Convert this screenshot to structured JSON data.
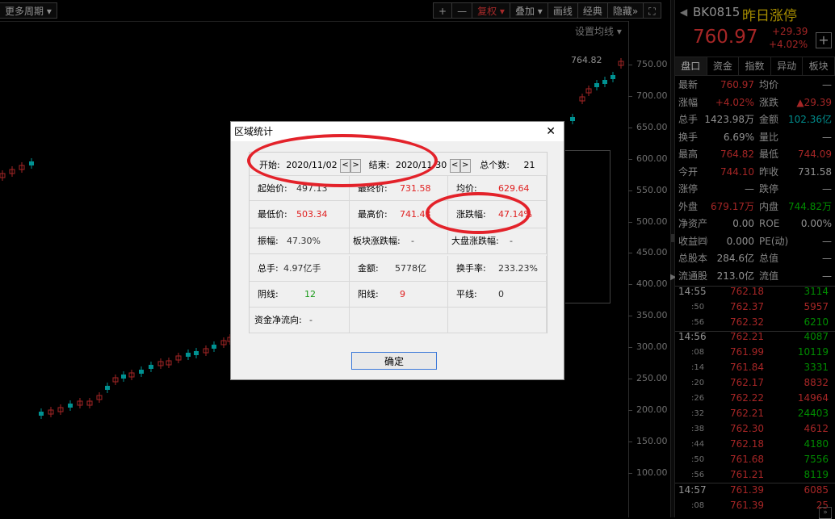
{
  "toolbar": {
    "more_period": "更多周期",
    "plus": "+",
    "minus": "—",
    "fuquan": "复权",
    "overlay": "叠加",
    "draw": "画线",
    "classic": "经典",
    "hide": "隐藏",
    "ma_settings": "设置均线"
  },
  "chart": {
    "price_tag": "764.82",
    "y_ticks": [
      "750.00",
      "700.00",
      "650.00",
      "600.00",
      "550.00",
      "500.00",
      "450.00",
      "400.00",
      "350.00",
      "300.00",
      "250.00",
      "200.00",
      "150.00",
      "100.00"
    ],
    "candles": [
      [
        0,
        215,
        "r"
      ],
      [
        12,
        210,
        "r"
      ],
      [
        24,
        205,
        "r"
      ],
      [
        36,
        200,
        "c"
      ],
      [
        48,
        510,
        "c"
      ],
      [
        60,
        508,
        "r"
      ],
      [
        72,
        505,
        "r"
      ],
      [
        84,
        500,
        "c"
      ],
      [
        96,
        497,
        "r"
      ],
      [
        108,
        497,
        "r"
      ],
      [
        120,
        490,
        "r"
      ],
      [
        130,
        478,
        "c"
      ],
      [
        140,
        468,
        "r"
      ],
      [
        150,
        464,
        "c"
      ],
      [
        160,
        462,
        "r"
      ],
      [
        172,
        458,
        "c"
      ],
      [
        184,
        452,
        "c"
      ],
      [
        196,
        448,
        "r"
      ],
      [
        206,
        447,
        "r"
      ],
      [
        218,
        441,
        "r"
      ],
      [
        230,
        437,
        "c"
      ],
      [
        240,
        435,
        "c"
      ],
      [
        252,
        432,
        "r"
      ],
      [
        262,
        427,
        "c"
      ],
      [
        274,
        422,
        "r"
      ],
      [
        282,
        418,
        "r"
      ],
      [
        706,
        145,
        "c"
      ],
      [
        718,
        120,
        "r"
      ],
      [
        726,
        110,
        "r"
      ],
      [
        736,
        103,
        "c"
      ],
      [
        746,
        99,
        "c"
      ],
      [
        756,
        93,
        "c"
      ],
      [
        766,
        76,
        "r"
      ]
    ]
  },
  "dialog": {
    "title": "区域统计",
    "start_label": "开始:",
    "start_date": "2020/11/02",
    "end_label": "结束:",
    "end_date": "2020/11/30",
    "total_label": "总个数:",
    "total_value": "21",
    "start_price_label": "起始价:",
    "start_price": "497.13",
    "end_price_label": "最终价:",
    "end_price": "731.58",
    "avg_label": "均价:",
    "avg_value": "629.64",
    "low_label": "最低价:",
    "low_value": "503.34",
    "high_label": "最高价:",
    "high_value": "741.43",
    "chg_label": "涨跌幅:",
    "chg_value": "47.14%",
    "amp_label": "振幅:",
    "amp_value": "47.30%",
    "sector_label": "板块涨跌幅:",
    "sector_value": "-",
    "market_label": "大盘涨跌幅:",
    "market_value": "-",
    "vol_label": "总手:",
    "vol_value": "4.97亿手",
    "amt_label": "金额:",
    "amt_value": "5778亿",
    "turn_label": "换手率:",
    "turn_value": "233.23%",
    "yin_label": "阴线:",
    "yin_value": "12",
    "yang_label": "阳线:",
    "yang_value": "9",
    "flat_label": "平线:",
    "flat_value": "0",
    "flow_label": "资金净流向:",
    "flow_value": "-",
    "ok": "确定",
    "close": "✕"
  },
  "right": {
    "code": "BK0815",
    "name": "昨日涨停",
    "price": "760.97",
    "chg": "+29.39",
    "pct": "+4.02%",
    "tabs": [
      "盘口",
      "资金",
      "指数",
      "异动",
      "板块"
    ],
    "quote_rows": [
      {
        "l1": "最新",
        "v1": "760.97",
        "c1": "red",
        "l2": "均价",
        "v2": "—",
        "c2": "white"
      },
      {
        "l1": "涨幅",
        "v1": "+4.02%",
        "c1": "red",
        "l2": "涨跌",
        "v2": "▲29.39",
        "c2": "red"
      },
      {
        "l1": "总手",
        "v1": "1423.98万",
        "c1": "white",
        "l2": "金额",
        "v2": "102.36亿",
        "c2": "cyan"
      },
      {
        "l1": "换手",
        "v1": "6.69%",
        "c1": "white",
        "l2": "量比",
        "v2": "—",
        "c2": "white"
      },
      {
        "l1": "最高",
        "v1": "764.82",
        "c1": "red",
        "l2": "最低",
        "v2": "744.09",
        "c2": "red"
      },
      {
        "l1": "今开",
        "v1": "744.10",
        "c1": "red",
        "l2": "昨收",
        "v2": "731.58",
        "c2": "white"
      },
      {
        "l1": "涨停",
        "v1": "—",
        "c1": "white",
        "l2": "跌停",
        "v2": "—",
        "c2": "white"
      },
      {
        "l1": "外盘",
        "v1": "679.17万",
        "c1": "red",
        "l2": "内盘",
        "v2": "744.82万",
        "c2": "green"
      },
      {
        "l1": "净资产",
        "v1": "0.00",
        "c1": "white",
        "l2": "ROE",
        "v2": "0.00%",
        "c2": "white"
      },
      {
        "l1": "收益㈣",
        "v1": "0.000",
        "c1": "white",
        "l2": "PE(动)",
        "v2": "—",
        "c2": "white"
      },
      {
        "l1": "总股本",
        "v1": "284.6亿",
        "c1": "white",
        "l2": "总值",
        "v2": "—",
        "c2": "white"
      },
      {
        "l1": "流通股",
        "v1": "213.0亿",
        "c1": "white",
        "l2": "流值",
        "v2": "—",
        "c2": "white"
      }
    ],
    "ticks": [
      {
        "t": "14:55",
        "p": "762.18",
        "v": "3114",
        "vc": "green"
      },
      {
        "t": ":50",
        "p": "762.37",
        "v": "5957",
        "vc": "red"
      },
      {
        "t": ":56",
        "p": "762.32",
        "v": "6210",
        "vc": "green"
      },
      {
        "t": "14:56",
        "p": "762.21",
        "v": "4087",
        "vc": "green"
      },
      {
        "t": ":08",
        "p": "761.99",
        "v": "10119",
        "vc": "green"
      },
      {
        "t": ":14",
        "p": "761.84",
        "v": "3331",
        "vc": "green"
      },
      {
        "t": ":20",
        "p": "762.17",
        "v": "8832",
        "vc": "red"
      },
      {
        "t": ":26",
        "p": "762.22",
        "v": "14964",
        "vc": "red"
      },
      {
        "t": ":32",
        "p": "762.21",
        "v": "24403",
        "vc": "green"
      },
      {
        "t": ":38",
        "p": "762.30",
        "v": "4612",
        "vc": "red"
      },
      {
        "t": ":44",
        "p": "762.18",
        "v": "4180",
        "vc": "green"
      },
      {
        "t": ":50",
        "p": "761.68",
        "v": "7556",
        "vc": "green"
      },
      {
        "t": ":56",
        "p": "761.21",
        "v": "8119",
        "vc": "green"
      },
      {
        "t": "14:57",
        "p": "761.39",
        "v": "6085",
        "vc": "red"
      },
      {
        "t": ":08",
        "p": "761.39",
        "v": "25",
        "vc": "red"
      }
    ]
  }
}
